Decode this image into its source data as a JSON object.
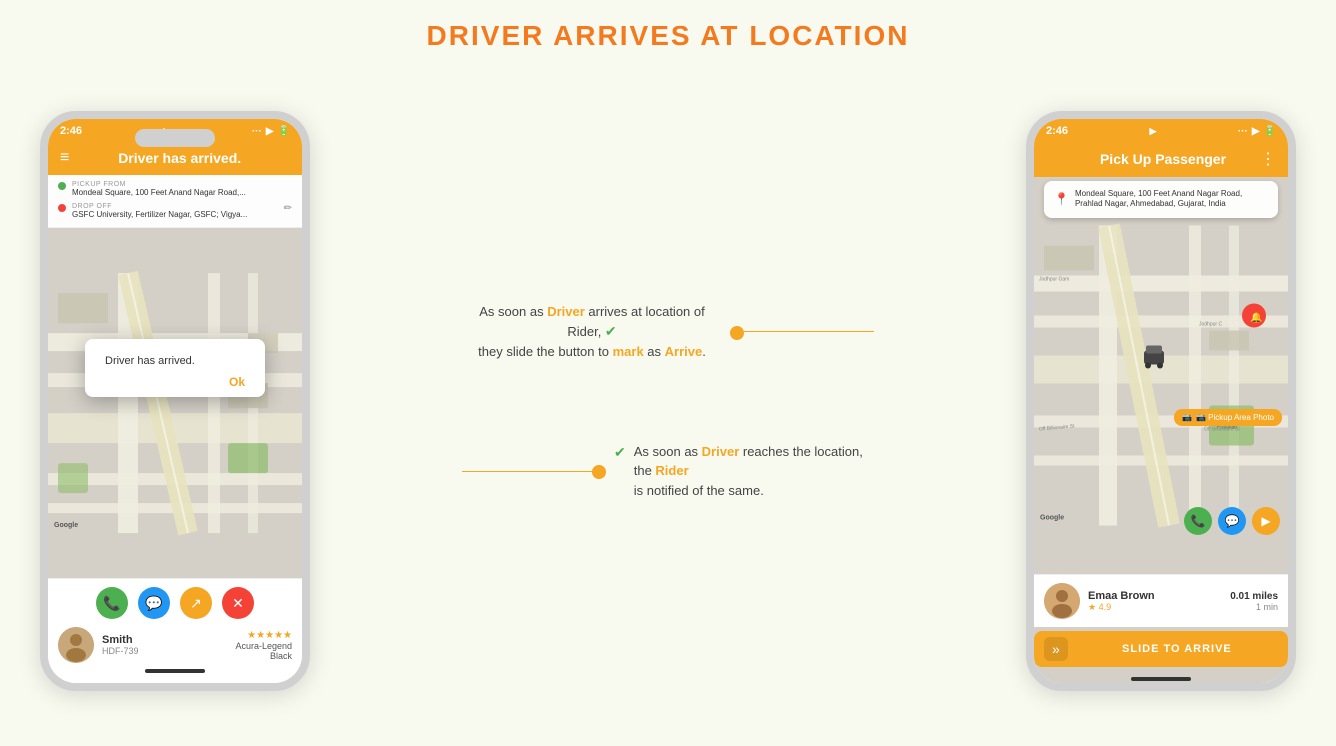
{
  "page": {
    "title": "DRIVER ARRIVES AT LOCATION",
    "background": "#f8faf0"
  },
  "left_phone": {
    "status_bar": {
      "time": "2:46",
      "icons": "◀ ··· ▶ 🔋"
    },
    "header": {
      "title": "Driver has arrived.",
      "menu_icon": "≡",
      "more_icon": "⋮"
    },
    "route": {
      "pickup_label": "PICKUP FROM",
      "pickup_address": "Mondeal Square, 100 Feet Anand Nagar Road,...",
      "dropoff_label": "DROP OFF",
      "dropoff_address": "GSFC University, Fertilizer Nagar, GSFC; Vigya..."
    },
    "dialog": {
      "text": "Driver has arrived.",
      "button": "Ok"
    },
    "action_buttons": [
      "📞",
      "💬",
      "↗",
      "✕"
    ],
    "driver": {
      "name": "Smith",
      "id": "HDF-739",
      "rating": "★★★★★",
      "car": "Acura-Legend",
      "color": "Black"
    }
  },
  "right_phone": {
    "status_bar": {
      "time": "2:46",
      "icons": "◀ ··· ▶ 🔋"
    },
    "header": {
      "title": "Pick Up Passenger",
      "more_icon": "⋮"
    },
    "address": "Mondeal Square, 100 Feet Anand Nagar Road, Prahlad Nagar, Ahmedabad, Gujarat, India",
    "pickup_photo_btn": "📷 Pickup Area Photo",
    "rider": {
      "name": "Emaa Brown",
      "rating": "★ 4.9",
      "distance": "0.01 miles",
      "time": "1 min"
    },
    "slide_to_arrive": "SLIDE TO ARRIVE"
  },
  "annotations": {
    "top": {
      "text_part1": "As soon as ",
      "text_highlight1": "Driver",
      "text_part2": " arrives at location of Rider, ",
      "text_part3": "they slide the button to ",
      "text_highlight2": "mark",
      "text_part4": " as ",
      "text_highlight3": "Arrive",
      "text_part5": "."
    },
    "bottom": {
      "text_part1": "As soon as ",
      "text_highlight1": "Driver",
      "text_part2": " reaches the location, the ",
      "text_highlight2": "Rider",
      "text_part3": " is notified of the same."
    }
  }
}
